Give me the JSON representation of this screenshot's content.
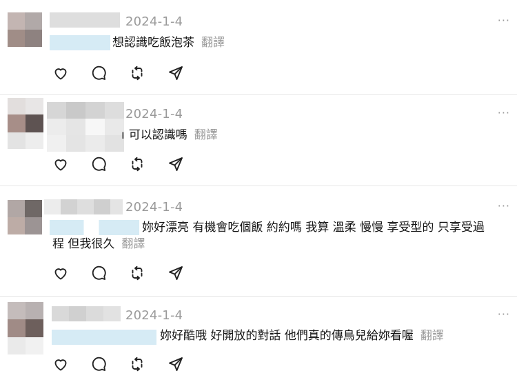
{
  "comments": [
    {
      "date": "2024-1-4",
      "text": "想認識吃飯泡茶",
      "translate_label": "翻譯",
      "more_label": "···"
    },
    {
      "date": "2024-1-4",
      "text": "可以認識嗎",
      "translate_label": "翻譯",
      "more_label": "···"
    },
    {
      "date": "2024-1-4",
      "text_line1": "妳好漂亮 有機會吃個飯 約約嗎 我算 溫柔 慢慢 享受型的 只享受過",
      "text_line2": "程 但我很久",
      "translate_label": "翻譯",
      "more_label": "···"
    },
    {
      "date": "2024-1-4",
      "text": "妳好酷哦 好開放的對話 他們真的傳鳥兒給妳看喔",
      "translate_label": "翻譯",
      "more_label": "···"
    }
  ],
  "colors": {
    "text": "#151515",
    "muted": "#9a9a9a",
    "divider": "#e6e6e6",
    "handle_blur": "#d6ebf5"
  }
}
